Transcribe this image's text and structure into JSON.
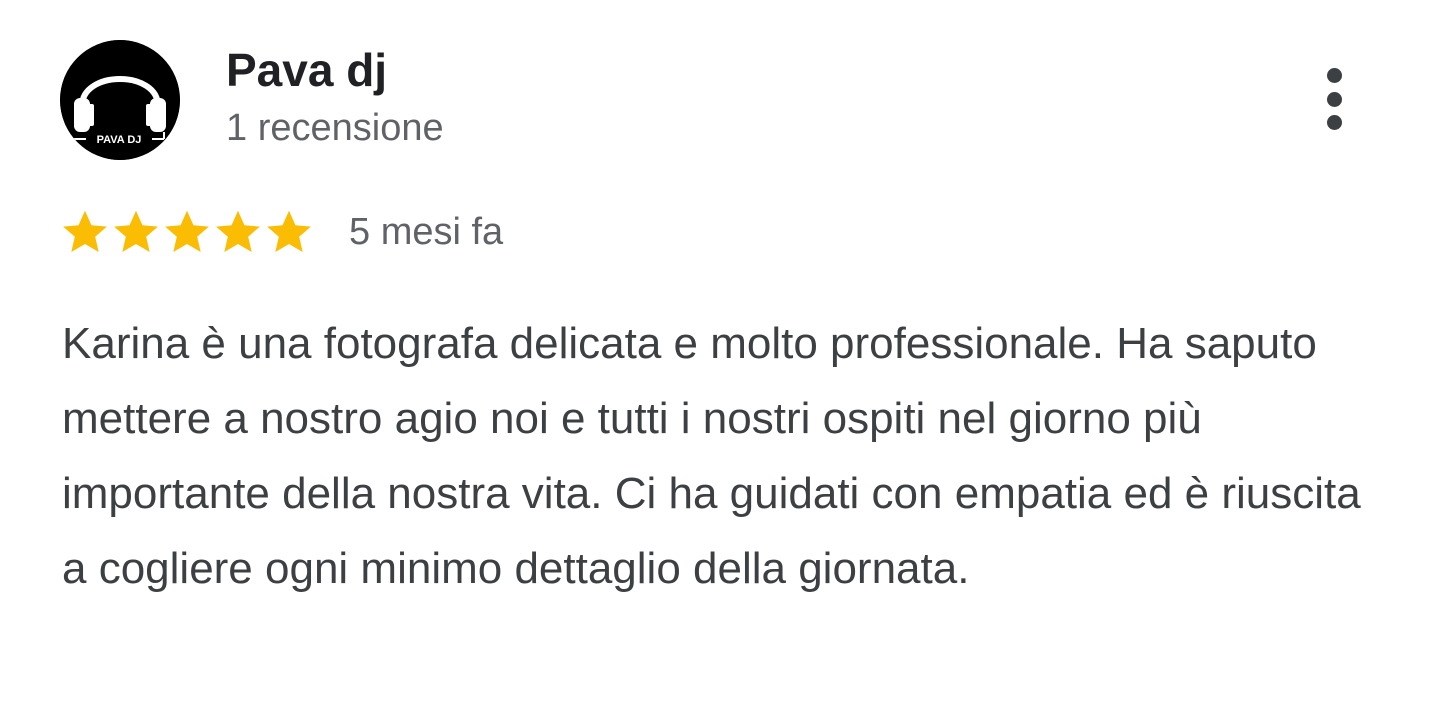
{
  "review": {
    "author": {
      "name": "Pava dj",
      "review_count": "1 recensione",
      "avatar_text": "PAVA DJ",
      "avatar_icon": "headphones-icon"
    },
    "menu_icon": "more-vert-icon",
    "rating": {
      "value": 5,
      "max": 5,
      "star_color": "#fbbc04"
    },
    "time": "5 mesi fa",
    "text": "Karina è una fotografa delicata e molto professionale. Ha saputo mettere a nostro agio noi e tutti i nostri ospiti nel giorno più importante della nostra vita. Ci ha guidati con empatia ed è riuscita a cogliere ogni minimo dettaglio della giornata."
  }
}
